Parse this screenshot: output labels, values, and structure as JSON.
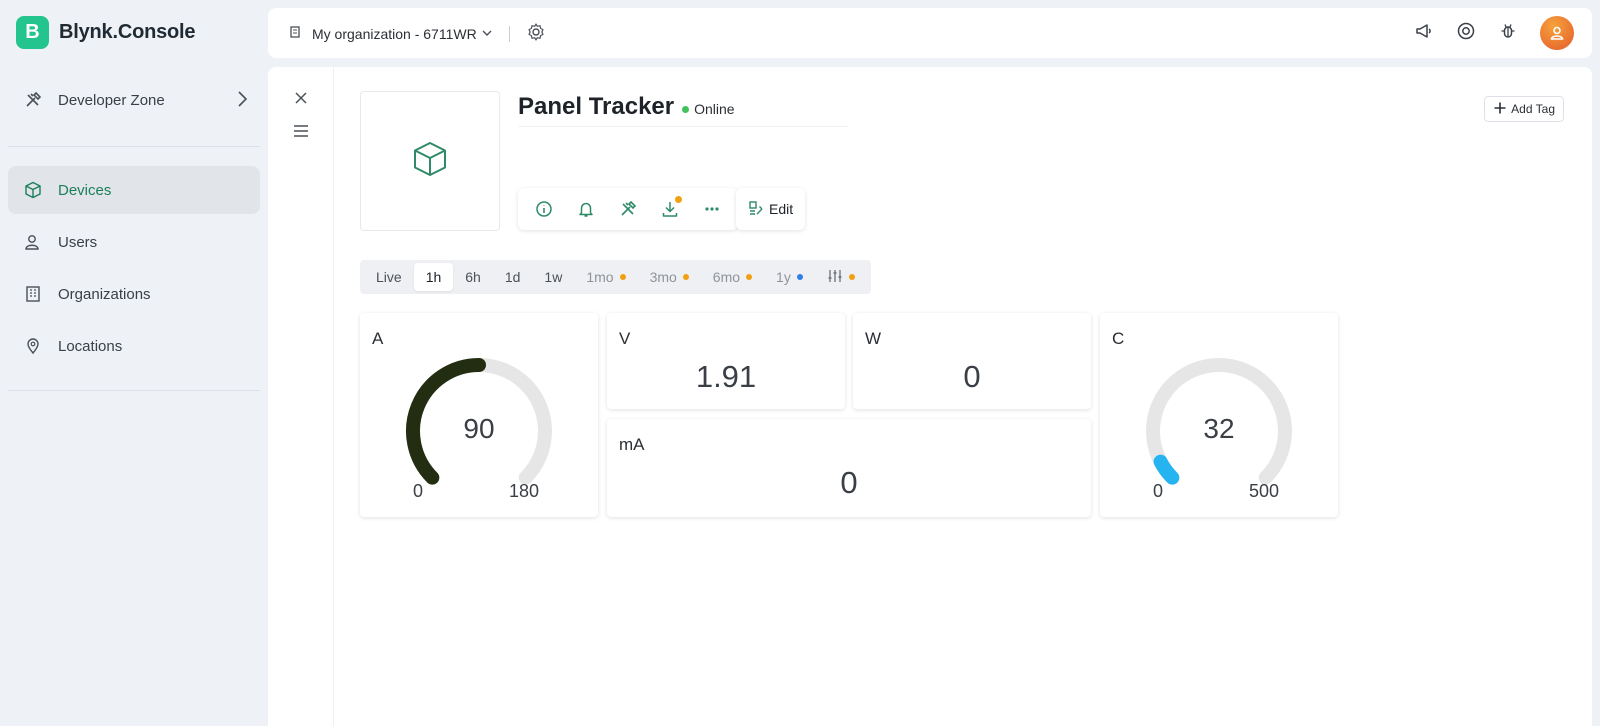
{
  "brand": {
    "logo_letter": "B",
    "name": "Blynk.Console",
    "color": "#23c48e"
  },
  "sidebar": {
    "developer_zone": "Developer Zone",
    "items": [
      {
        "label": "Devices",
        "icon": "cube-icon",
        "active": true
      },
      {
        "label": "Users",
        "icon": "users-icon",
        "active": false
      },
      {
        "label": "Organizations",
        "icon": "building-icon",
        "active": false
      },
      {
        "label": "Locations",
        "icon": "location-pin-icon",
        "active": false
      }
    ]
  },
  "topbar": {
    "organization": "My organization - 6711WR"
  },
  "device": {
    "name": "Panel Tracker",
    "status": "Online",
    "status_color": "#3fc35a"
  },
  "actions": {
    "edit_label": "Edit",
    "add_tag_label": "Add Tag"
  },
  "time_tabs": [
    {
      "label": "Live",
      "active": false,
      "muted": false,
      "dot": null
    },
    {
      "label": "1h",
      "active": true,
      "muted": false,
      "dot": null
    },
    {
      "label": "6h",
      "active": false,
      "muted": false,
      "dot": null
    },
    {
      "label": "1d",
      "active": false,
      "muted": false,
      "dot": null
    },
    {
      "label": "1w",
      "active": false,
      "muted": false,
      "dot": null
    },
    {
      "label": "1mo",
      "active": false,
      "muted": true,
      "dot": "#f0a010"
    },
    {
      "label": "3mo",
      "active": false,
      "muted": true,
      "dot": "#f0a010"
    },
    {
      "label": "6mo",
      "active": false,
      "muted": true,
      "dot": "#f0a010"
    },
    {
      "label": "1y",
      "active": false,
      "muted": true,
      "dot": "#2f80ed"
    }
  ],
  "custom_range_dot": "#f0a010",
  "widgets": {
    "a": {
      "label": "A",
      "value": "90",
      "min": "0",
      "max": "180",
      "fraction": 0.5,
      "color": "#232d12"
    },
    "v": {
      "label": "V",
      "value": "1.91"
    },
    "w": {
      "label": "W",
      "value": "0"
    },
    "ma": {
      "label": "mA",
      "value": "0"
    },
    "c": {
      "label": "C",
      "value": "32",
      "min": "0",
      "max": "500",
      "fraction": 0.064,
      "color": "#26b4f0"
    }
  }
}
